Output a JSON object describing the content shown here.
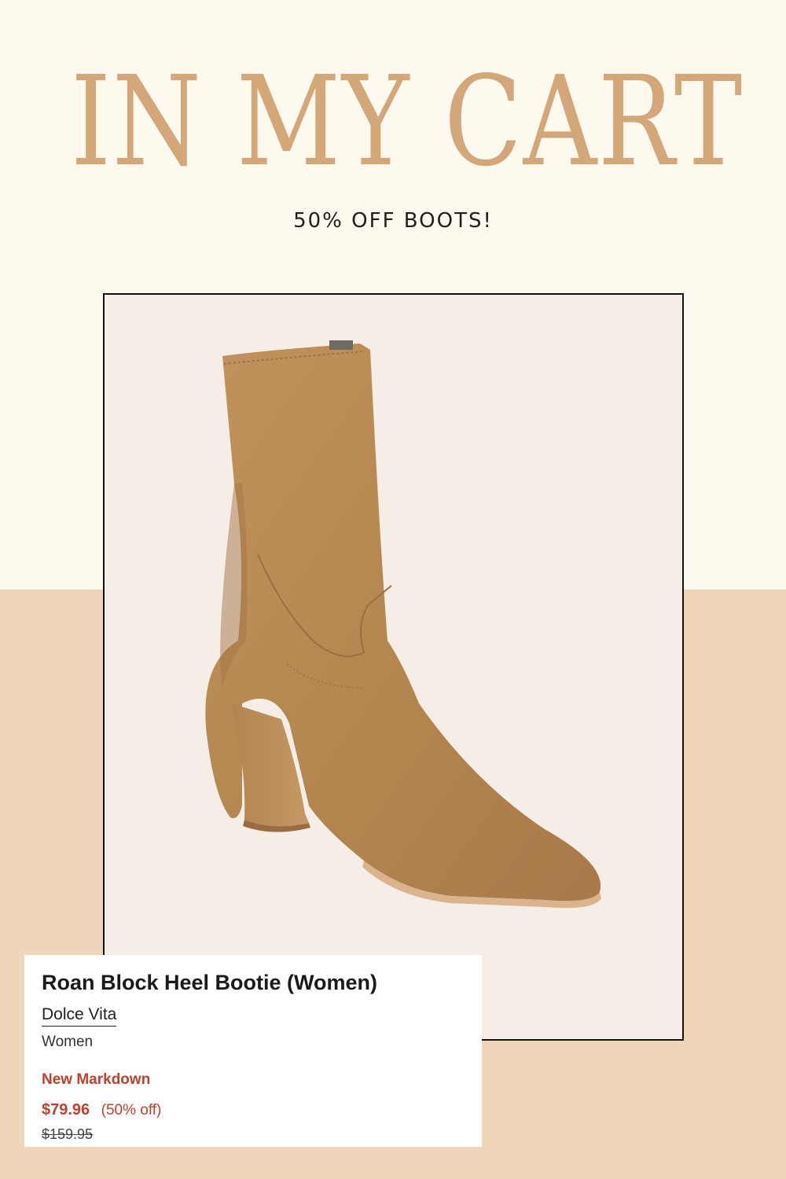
{
  "header": {
    "title": "IN MY CART",
    "subtitle": "50% OFF BOOTS!"
  },
  "photo": {
    "icon": "suede-ankle-boot-image"
  },
  "product": {
    "name": "Roan Block Heel Bootie (Women)",
    "brand": "Dolce Vita",
    "category": "Women",
    "badge": "New Markdown",
    "sale_price": "$79.96",
    "discount": "(50% off)",
    "original_price": "$159.95"
  },
  "colors": {
    "cream_background": "#fdf9ef",
    "tan_band": "#efd6bb",
    "title_gold": "#d3a777",
    "sale_red": "#c2402a",
    "boot_suede": "#b88a55"
  }
}
